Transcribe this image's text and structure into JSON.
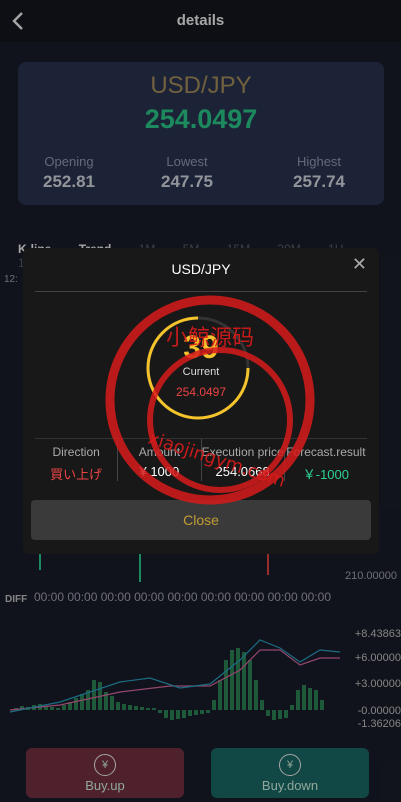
{
  "header": {
    "title": "details"
  },
  "card": {
    "pair": "USD/JPY",
    "price": "254.0497",
    "opening_label": "Opening",
    "opening_value": "252.81",
    "lowest_label": "Lowest",
    "lowest_value": "247.75",
    "highest_label": "Highest",
    "highest_value": "257.74"
  },
  "tabs": [
    "K-line",
    "Trend",
    "1M",
    "5M",
    "15M",
    "30M",
    "1H",
    "1D"
  ],
  "chart": {
    "left_time_label": "12:",
    "y_labels": [
      "210.00000"
    ],
    "time_labels": [
      "00:00",
      "00:00",
      "00:00",
      "00:00",
      "00:00",
      "00:00",
      "00:00",
      "00:00",
      "00:00",
      "00:00",
      "00:00"
    ],
    "diff_label": "DIFF"
  },
  "macd": {
    "labels": [
      "+8.43863",
      "+6.00000",
      "+3.00000",
      "-0.00000",
      "-1.36206"
    ]
  },
  "buttons": {
    "buy_up": "Buy.up",
    "buy_down": "Buy.down",
    "up_icon": "yen-up-icon",
    "down_icon": "yen-down-icon"
  },
  "modal": {
    "title": "USD/JPY",
    "countdown": "39",
    "current_label": "Current",
    "current_value": "254.0497",
    "direction_label": "Direction",
    "direction_value": "買い上げ",
    "amount_label": "Amount",
    "amount_value": "¥ 1000",
    "execution_label": "Execution price",
    "execution_value": "254.0668",
    "forecast_label": "Forecast.result",
    "forecast_value": "￥-1000",
    "close_label": "Close"
  },
  "watermark": {
    "text_top": "小鲸源码",
    "text_bottom": "xiaojingym.com"
  },
  "colors": {
    "green": "#2bd391",
    "red": "#e44",
    "gold": "#c49c35"
  }
}
